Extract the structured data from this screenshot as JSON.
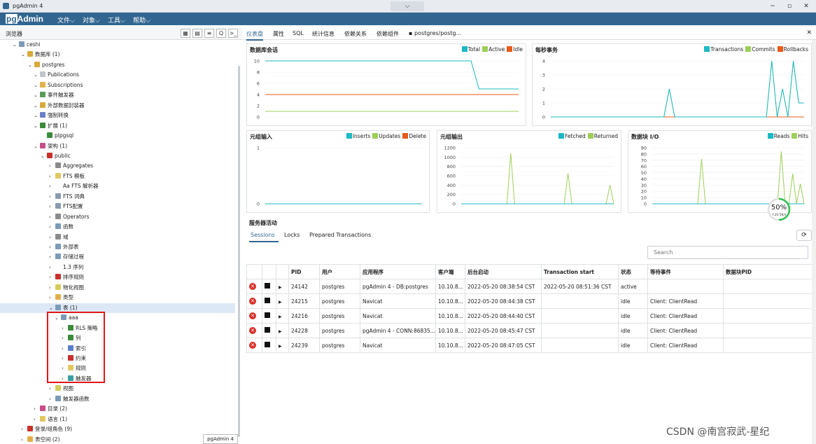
{
  "window": {
    "title": "pgAdmin 4",
    "dropdown_icon": "⌵",
    "min": "−",
    "max": "▫",
    "close": "✕"
  },
  "menubar": {
    "logo_pg": "pg",
    "logo_admin": "Admin",
    "items": [
      "文件⌵",
      "对象⌵",
      "工具⌵",
      "帮助⌵"
    ]
  },
  "browser": {
    "label": "浏览器",
    "tools": [
      "▦",
      "▤",
      "≡",
      "Q",
      ">_"
    ]
  },
  "tree": [
    {
      "label": "ceshi",
      "arrow": "⌄",
      "color": "#7c9bb8"
    },
    {
      "label": "数据库 (1)",
      "arrow": "⌄",
      "color": "#d9a93b"
    },
    {
      "label": "postgres",
      "arrow": "⌄",
      "color": "#d9a93b"
    },
    {
      "label": "Publications",
      "arrow": "⌄",
      "color": "#c0c6cc"
    },
    {
      "label": "Subscriptions",
      "arrow": "⌄",
      "color": "#e2b04a"
    },
    {
      "label": "事件触发器",
      "arrow": "⌄",
      "color": "#5a9a5a"
    },
    {
      "label": "外部数据封装器",
      "arrow": "⌄",
      "color": "#d9a93b"
    },
    {
      "label": "强制转换",
      "arrow": "⌄",
      "color": "#6a7fc8"
    },
    {
      "label": "扩展 (1)",
      "arrow": "⌄",
      "color": "#3a8a3a"
    },
    {
      "label": "plpgsql",
      "arrow": "",
      "color": "#3a8a3a"
    },
    {
      "label": "架构 (1)",
      "arrow": "⌄",
      "color": "#c94c8a"
    },
    {
      "label": "public",
      "arrow": "⌄",
      "color": "#c9302c"
    },
    {
      "label": "Aggregates",
      "arrow": "›",
      "color": "#8a8a8a"
    },
    {
      "label": "FTS 模板",
      "arrow": "›",
      "color": "#e2c860"
    },
    {
      "label": "Aa FTS 解析器",
      "arrow": "›",
      "color": "#ffffff"
    },
    {
      "label": "FTS 词典",
      "arrow": "›",
      "color": "#8a9bb0"
    },
    {
      "label": "FTS配置",
      "arrow": "›",
      "color": "#8a9bb0"
    },
    {
      "label": "Operators",
      "arrow": "›",
      "color": "#8a8a8a"
    },
    {
      "label": "函数",
      "arrow": "›",
      "color": "#7c9bb8"
    },
    {
      "label": "域",
      "arrow": "›",
      "color": "#8a8a8a"
    },
    {
      "label": "外部表",
      "arrow": "›",
      "color": "#7c9bb8"
    },
    {
      "label": "存储过程",
      "arrow": "›",
      "color": "#7c9bb8"
    },
    {
      "label": "1.3 序列",
      "arrow": "›",
      "color": "#ffffff"
    },
    {
      "label": "排序规则",
      "arrow": "›",
      "color": "#c9302c"
    },
    {
      "label": "物化视图",
      "arrow": "›",
      "color": "#d6cc5a"
    },
    {
      "label": "类型",
      "arrow": "›",
      "color": "#e2b04a"
    },
    {
      "label": "表 (1)",
      "arrow": "⌄",
      "color": "#7c9bb8",
      "selected": true
    },
    {
      "label": "aaa",
      "arrow": "⌄",
      "color": "#7c9bb8"
    },
    {
      "label": "RLS 策略",
      "arrow": "›",
      "color": "#3a8a3a"
    },
    {
      "label": "列",
      "arrow": "›",
      "color": "#3a8a3a"
    },
    {
      "label": "索引",
      "arrow": "›",
      "color": "#5a7fc8"
    },
    {
      "label": "约束",
      "arrow": "›",
      "color": "#c9302c"
    },
    {
      "label": "规则",
      "arrow": "›",
      "color": "#e2c860"
    },
    {
      "label": "触发器",
      "arrow": "›",
      "color": "#3aa0a0"
    },
    {
      "label": "视图",
      "arrow": "›",
      "color": "#d6cc5a"
    },
    {
      "label": "触发器函数",
      "arrow": "›",
      "color": "#7c9bb8"
    },
    {
      "label": "目录 (2)",
      "arrow": "›",
      "color": "#c94c8a"
    },
    {
      "label": "语言 (1)",
      "arrow": "›",
      "color": "#e2c860"
    },
    {
      "label": "登录/组角色 (9)",
      "arrow": "›",
      "color": "#c9302c"
    },
    {
      "label": "表空间 (2)",
      "arrow": "›",
      "color": "#e2b04a"
    }
  ],
  "status_tab": "pgAdmin 4",
  "tabs": [
    "仪表盘",
    "属性",
    "SQL",
    "统计信息",
    "依赖关系",
    "依赖组件",
    "postgres/postg..."
  ],
  "colors": {
    "teal": "#1ab9c5",
    "green": "#9dcf58",
    "orange": "#e8591a"
  },
  "charts": [
    {
      "title": "数据库会话",
      "type": "line",
      "ylim": [
        0,
        10
      ],
      "yticks": [
        "0",
        "2",
        "4",
        "6",
        "8",
        "10"
      ],
      "legend": [
        "Total",
        "Active",
        "Idle"
      ],
      "series": [
        {
          "name": "Total",
          "color": "#1ab9c5",
          "values": [
            10,
            10,
            10,
            10,
            10,
            10,
            10,
            10,
            10,
            10,
            10,
            10,
            10,
            10,
            10,
            10,
            10,
            10,
            10,
            10,
            10,
            10,
            10,
            10,
            10,
            10,
            10,
            5,
            5,
            5,
            5,
            5,
            5
          ]
        },
        {
          "name": "Active",
          "color": "#9dcf58",
          "values": [
            1,
            1,
            1,
            1,
            1,
            1,
            1,
            1,
            1,
            1,
            1,
            1,
            1,
            1,
            1,
            1,
            1,
            1,
            1,
            1,
            1,
            1,
            1,
            1,
            1,
            1,
            1,
            1,
            1,
            1,
            1,
            1,
            1
          ]
        },
        {
          "name": "Idle",
          "color": "#e8591a",
          "values": [
            4,
            4,
            4,
            4,
            4,
            4,
            4,
            4,
            4,
            4,
            4,
            4,
            4,
            4,
            4,
            4,
            4,
            4,
            4,
            4,
            4,
            4,
            4,
            4,
            4,
            4,
            4,
            4,
            4,
            4,
            4,
            4,
            4
          ]
        }
      ]
    },
    {
      "title": "每秒事务",
      "type": "line",
      "ylim": [
        0,
        4
      ],
      "yticks": [
        "0",
        "1",
        "2",
        "3",
        "4"
      ],
      "legend": [
        "Transactions",
        "Commits",
        "Rollbacks"
      ],
      "series": [
        {
          "name": "Transactions",
          "color": "#1ab9c5",
          "values": [
            0,
            0,
            0,
            0,
            0,
            0,
            0,
            0,
            0,
            0,
            0,
            0,
            0,
            0,
            0,
            0,
            0,
            0,
            0,
            0,
            0,
            0,
            2,
            0,
            0,
            0,
            0,
            0,
            0,
            0,
            0,
            0,
            0,
            0,
            0,
            0,
            0,
            0,
            0,
            0,
            0,
            4,
            0,
            2,
            0,
            4,
            1,
            1
          ]
        },
        {
          "name": "Commits",
          "color": "#9dcf58",
          "values": [
            0,
            0,
            0,
            0,
            0,
            0,
            0,
            0,
            0,
            0,
            0,
            0,
            0,
            0,
            0,
            0,
            0,
            0,
            0,
            0,
            0,
            0,
            2,
            0,
            0,
            0,
            0,
            0,
            0,
            0,
            0,
            0,
            0,
            0,
            0,
            0,
            0,
            0,
            0,
            0,
            0,
            4,
            0,
            2,
            0,
            4,
            1,
            1
          ]
        },
        {
          "name": "Rollbacks",
          "color": "#e8591a",
          "values": [
            0,
            0,
            0,
            0,
            0,
            0,
            0,
            0,
            0,
            0,
            0,
            0,
            0,
            0,
            0,
            0,
            0,
            0,
            0,
            0,
            0,
            0,
            0,
            0,
            0,
            0,
            0,
            0,
            0,
            0,
            0,
            0,
            0,
            0,
            0,
            0,
            0,
            0,
            0,
            0,
            0,
            0,
            0,
            0,
            0,
            0,
            0,
            0
          ]
        }
      ]
    },
    {
      "title": "元组输入",
      "type": "line",
      "ylim": [
        0,
        1
      ],
      "yticks": [
        "0",
        "1"
      ],
      "legend": [
        "Inserts",
        "Updates",
        "Delete"
      ],
      "series": [
        {
          "name": "Inserts",
          "color": "#1ab9c5",
          "values": [
            0,
            0,
            0,
            0,
            0,
            0,
            0,
            0,
            0,
            0
          ]
        },
        {
          "name": "Updates",
          "color": "#9dcf58",
          "values": [
            0,
            0,
            0,
            0,
            0,
            0,
            0,
            0,
            0,
            0
          ]
        },
        {
          "name": "Delete",
          "color": "#e8591a",
          "values": [
            0,
            0,
            0,
            0,
            0,
            0,
            0,
            0,
            0,
            0
          ]
        }
      ]
    },
    {
      "title": "元组输出",
      "type": "line",
      "ylim": [
        0,
        1200
      ],
      "yticks": [
        "0",
        "200",
        "400",
        "600",
        "800",
        "1000",
        "1200"
      ],
      "legend": [
        "Fetched",
        "Returned"
      ],
      "series": [
        {
          "name": "Fetched",
          "color": "#1ab9c5",
          "values": [
            0,
            0,
            0,
            0,
            0,
            0,
            0,
            0,
            0,
            0,
            0,
            0,
            0,
            0,
            0,
            0,
            0,
            0,
            0,
            0,
            0,
            0,
            0,
            0,
            0,
            0,
            0,
            0,
            0,
            0,
            0,
            0,
            0,
            0,
            0,
            0,
            0,
            0,
            0,
            0
          ]
        },
        {
          "name": "Returned",
          "color": "#9dcf58",
          "values": [
            0,
            0,
            0,
            0,
            0,
            0,
            0,
            0,
            0,
            0,
            0,
            0,
            0,
            1080,
            0,
            0,
            0,
            0,
            0,
            0,
            0,
            0,
            0,
            0,
            0,
            0,
            0,
            0,
            650,
            0,
            0,
            0,
            0,
            0,
            0,
            0,
            0,
            0,
            0,
            400,
            0
          ]
        }
      ]
    },
    {
      "title": "数据块 I/O",
      "type": "line",
      "ylim": [
        0,
        90
      ],
      "yticks": [
        "0",
        "10",
        "20",
        "30",
        "40",
        "50",
        "60",
        "70",
        "80",
        "90"
      ],
      "legend": [
        "Reads",
        "Hits"
      ],
      "series": [
        {
          "name": "Reads",
          "color": "#1ab9c5",
          "values": [
            0,
            0,
            0,
            0,
            0,
            0,
            0,
            0,
            0,
            0,
            0,
            0,
            0,
            0,
            0,
            0,
            0,
            0,
            0,
            0,
            0,
            0,
            0,
            0,
            0,
            0,
            0,
            0,
            0,
            0,
            0,
            0,
            0,
            0,
            0,
            0,
            0,
            0,
            0,
            0,
            0
          ]
        },
        {
          "name": "Hits",
          "color": "#9dcf58",
          "values": [
            0,
            0,
            0,
            0,
            0,
            0,
            0,
            0,
            0,
            0,
            0,
            0,
            0,
            72,
            0,
            0,
            0,
            0,
            0,
            0,
            0,
            0,
            0,
            0,
            0,
            0,
            0,
            0,
            0,
            0,
            0,
            0,
            0,
            0,
            84,
            0,
            0,
            48,
            0,
            32,
            0
          ]
        }
      ]
    }
  ],
  "gauge": {
    "value_label": "50%",
    "sub_label": "↑20.5K/s",
    "percent": 50
  },
  "activity": {
    "title": "服务器活动",
    "tabs": [
      "Sessions",
      "Locks",
      "Prepared Transactions"
    ],
    "refresh_icon": "⟳",
    "search_placeholder": "Search"
  },
  "table": {
    "headers": [
      "",
      "",
      "",
      "PID",
      "用户",
      "应用程序",
      "客户端",
      "后台启动",
      "Transaction start",
      "状态",
      "等待事件",
      "数据块PID"
    ],
    "rows": [
      [
        "24142",
        "postgres",
        "pgAdmin 4 - DB:postgres",
        "10.10.8...",
        "2022-05-20 08:38:54 CST",
        "2022-05-20 08:51:36 CST",
        "active",
        "",
        ""
      ],
      [
        "24215",
        "postgres",
        "Navicat",
        "10.10.8...",
        "2022-05-20 08:44:38 CST",
        "",
        "idle",
        "Client: ClientRead",
        ""
      ],
      [
        "24216",
        "postgres",
        "Navicat",
        "10.10.8...",
        "2022-05-20 08:44:40 CST",
        "",
        "idle",
        "Client: ClientRead",
        ""
      ],
      [
        "24228",
        "postgres",
        "pgAdmin 4 - CONN:86835...",
        "10.10.8...",
        "2022-05-20 08:45:47 CST",
        "",
        "idle",
        "Client: ClientRead",
        ""
      ],
      [
        "24239",
        "postgres",
        "Navicat",
        "10.10.8...",
        "2022-05-20 08:47:05 CST",
        "",
        "idle",
        "Client: ClientRead",
        ""
      ]
    ]
  },
  "watermark": "CSDN @南宫寂武-星纪"
}
